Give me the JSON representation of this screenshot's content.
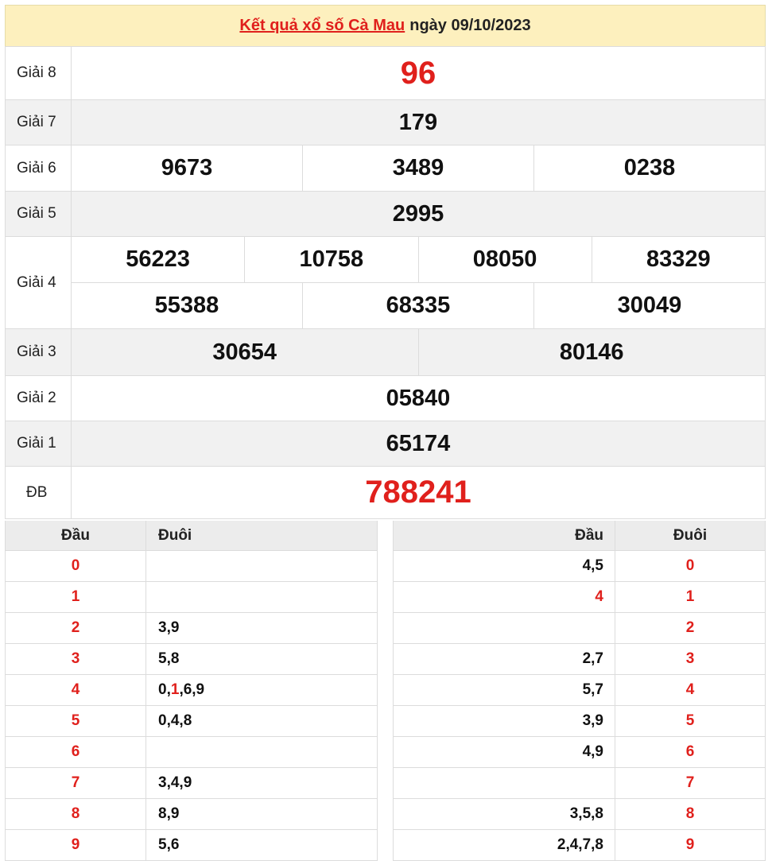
{
  "header": {
    "link_text": "Kết quả xổ số Cà Mau",
    "date_text": "ngày 09/10/2023"
  },
  "prizes": {
    "g8": {
      "label": "Giải 8",
      "numbers": [
        "96"
      ]
    },
    "g7": {
      "label": "Giải 7",
      "numbers": [
        "179"
      ]
    },
    "g6": {
      "label": "Giải 6",
      "numbers": [
        "9673",
        "3489",
        "0238"
      ]
    },
    "g5": {
      "label": "Giải 5",
      "numbers": [
        "2995"
      ]
    },
    "g4": {
      "label": "Giải 4",
      "numbers": [
        "56223",
        "10758",
        "08050",
        "83329",
        "55388",
        "68335",
        "30049"
      ]
    },
    "g3": {
      "label": "Giải 3",
      "numbers": [
        "30654",
        "80146"
      ]
    },
    "g2": {
      "label": "Giải 2",
      "numbers": [
        "05840"
      ]
    },
    "g1": {
      "label": "Giải 1",
      "numbers": [
        "65174"
      ]
    },
    "db": {
      "label": "ĐB",
      "numbers": [
        "788241"
      ]
    }
  },
  "loto_left": {
    "headers": [
      "Đầu",
      "Đuôi"
    ],
    "rows": [
      {
        "dau": "0",
        "duoi": ""
      },
      {
        "dau": "1",
        "duoi": ""
      },
      {
        "dau": "2",
        "duoi": "3,9"
      },
      {
        "dau": "3",
        "duoi": "5,8"
      },
      {
        "dau": "4",
        "duoi_pre": "0,",
        "duoi_hl": "1",
        "duoi_post": ",6,9"
      },
      {
        "dau": "5",
        "duoi": "0,4,8"
      },
      {
        "dau": "6",
        "duoi": ""
      },
      {
        "dau": "7",
        "duoi": "3,4,9"
      },
      {
        "dau": "8",
        "duoi": "8,9"
      },
      {
        "dau": "9",
        "duoi": "5,6"
      }
    ]
  },
  "loto_right": {
    "headers": [
      "Đầu",
      "Đuôi"
    ],
    "rows": [
      {
        "dau": "4,5",
        "duoi": "0"
      },
      {
        "dau": "4",
        "duoi": "1"
      },
      {
        "dau": "",
        "duoi": "2"
      },
      {
        "dau": "2,7",
        "duoi": "3"
      },
      {
        "dau": "5,7",
        "duoi": "4"
      },
      {
        "dau": "3,9",
        "duoi": "5"
      },
      {
        "dau": "4,9",
        "duoi": "6"
      },
      {
        "dau": "",
        "duoi": "7"
      },
      {
        "dau": "3,5,8",
        "duoi": "8"
      },
      {
        "dau": "2,4,7,8",
        "duoi": "9"
      }
    ]
  },
  "colors": {
    "accent_red": "#e0201c",
    "header_bg": "#fdf0be",
    "row_alt": "#f1f1f1"
  }
}
